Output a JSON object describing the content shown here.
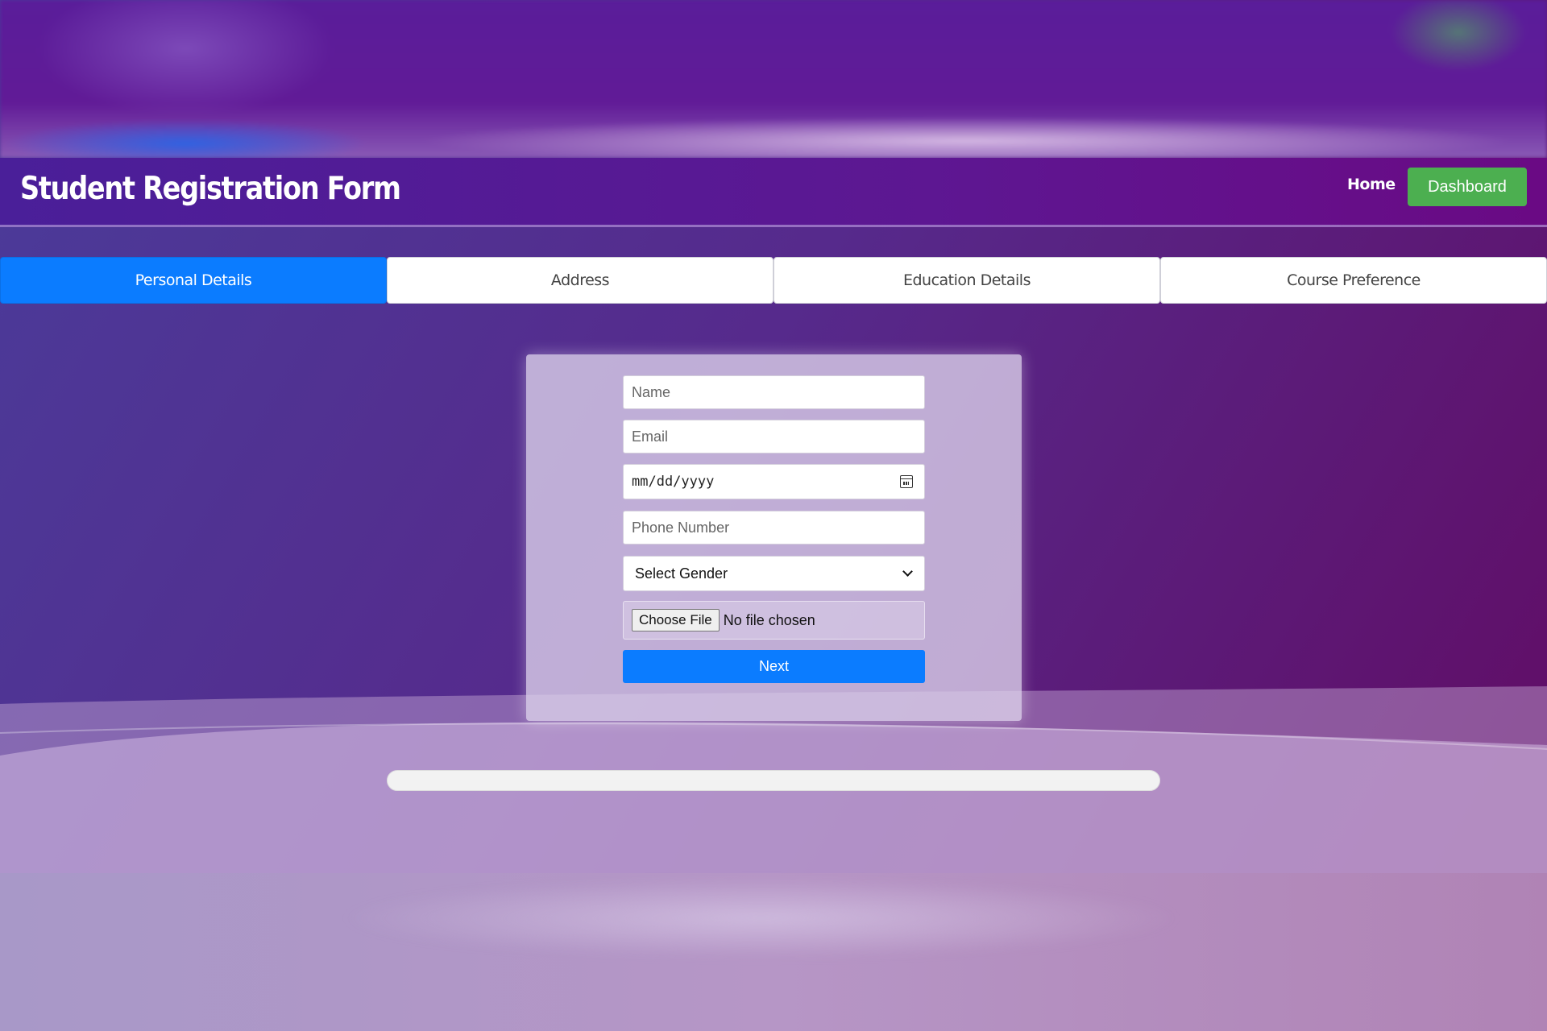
{
  "header": {
    "title": "Student Registration Form",
    "nav_home": "Home",
    "nav_dashboard": "Dashboard"
  },
  "tabs": [
    {
      "label": "Personal Details",
      "active": true
    },
    {
      "label": "Address",
      "active": false
    },
    {
      "label": "Education Details",
      "active": false
    },
    {
      "label": "Course Preference",
      "active": false
    }
  ],
  "form": {
    "name_placeholder": "Name",
    "email_placeholder": "Email",
    "dob_placeholder": "mm/dd/yyyy",
    "phone_placeholder": "Phone Number",
    "gender_selected": "Select Gender",
    "file_button": "Choose File",
    "file_status": "No file chosen",
    "next_label": "Next"
  },
  "progress": {
    "fraction": 0
  },
  "icons": {
    "date": "calendar-icon",
    "select": "chevron-down-icon"
  },
  "colors": {
    "primary": "#0b7cff",
    "dashboard_button": "#4caf50",
    "header_bg": "#5a1a95",
    "background_start": "#4a3c9a",
    "background_end": "#620a62"
  }
}
